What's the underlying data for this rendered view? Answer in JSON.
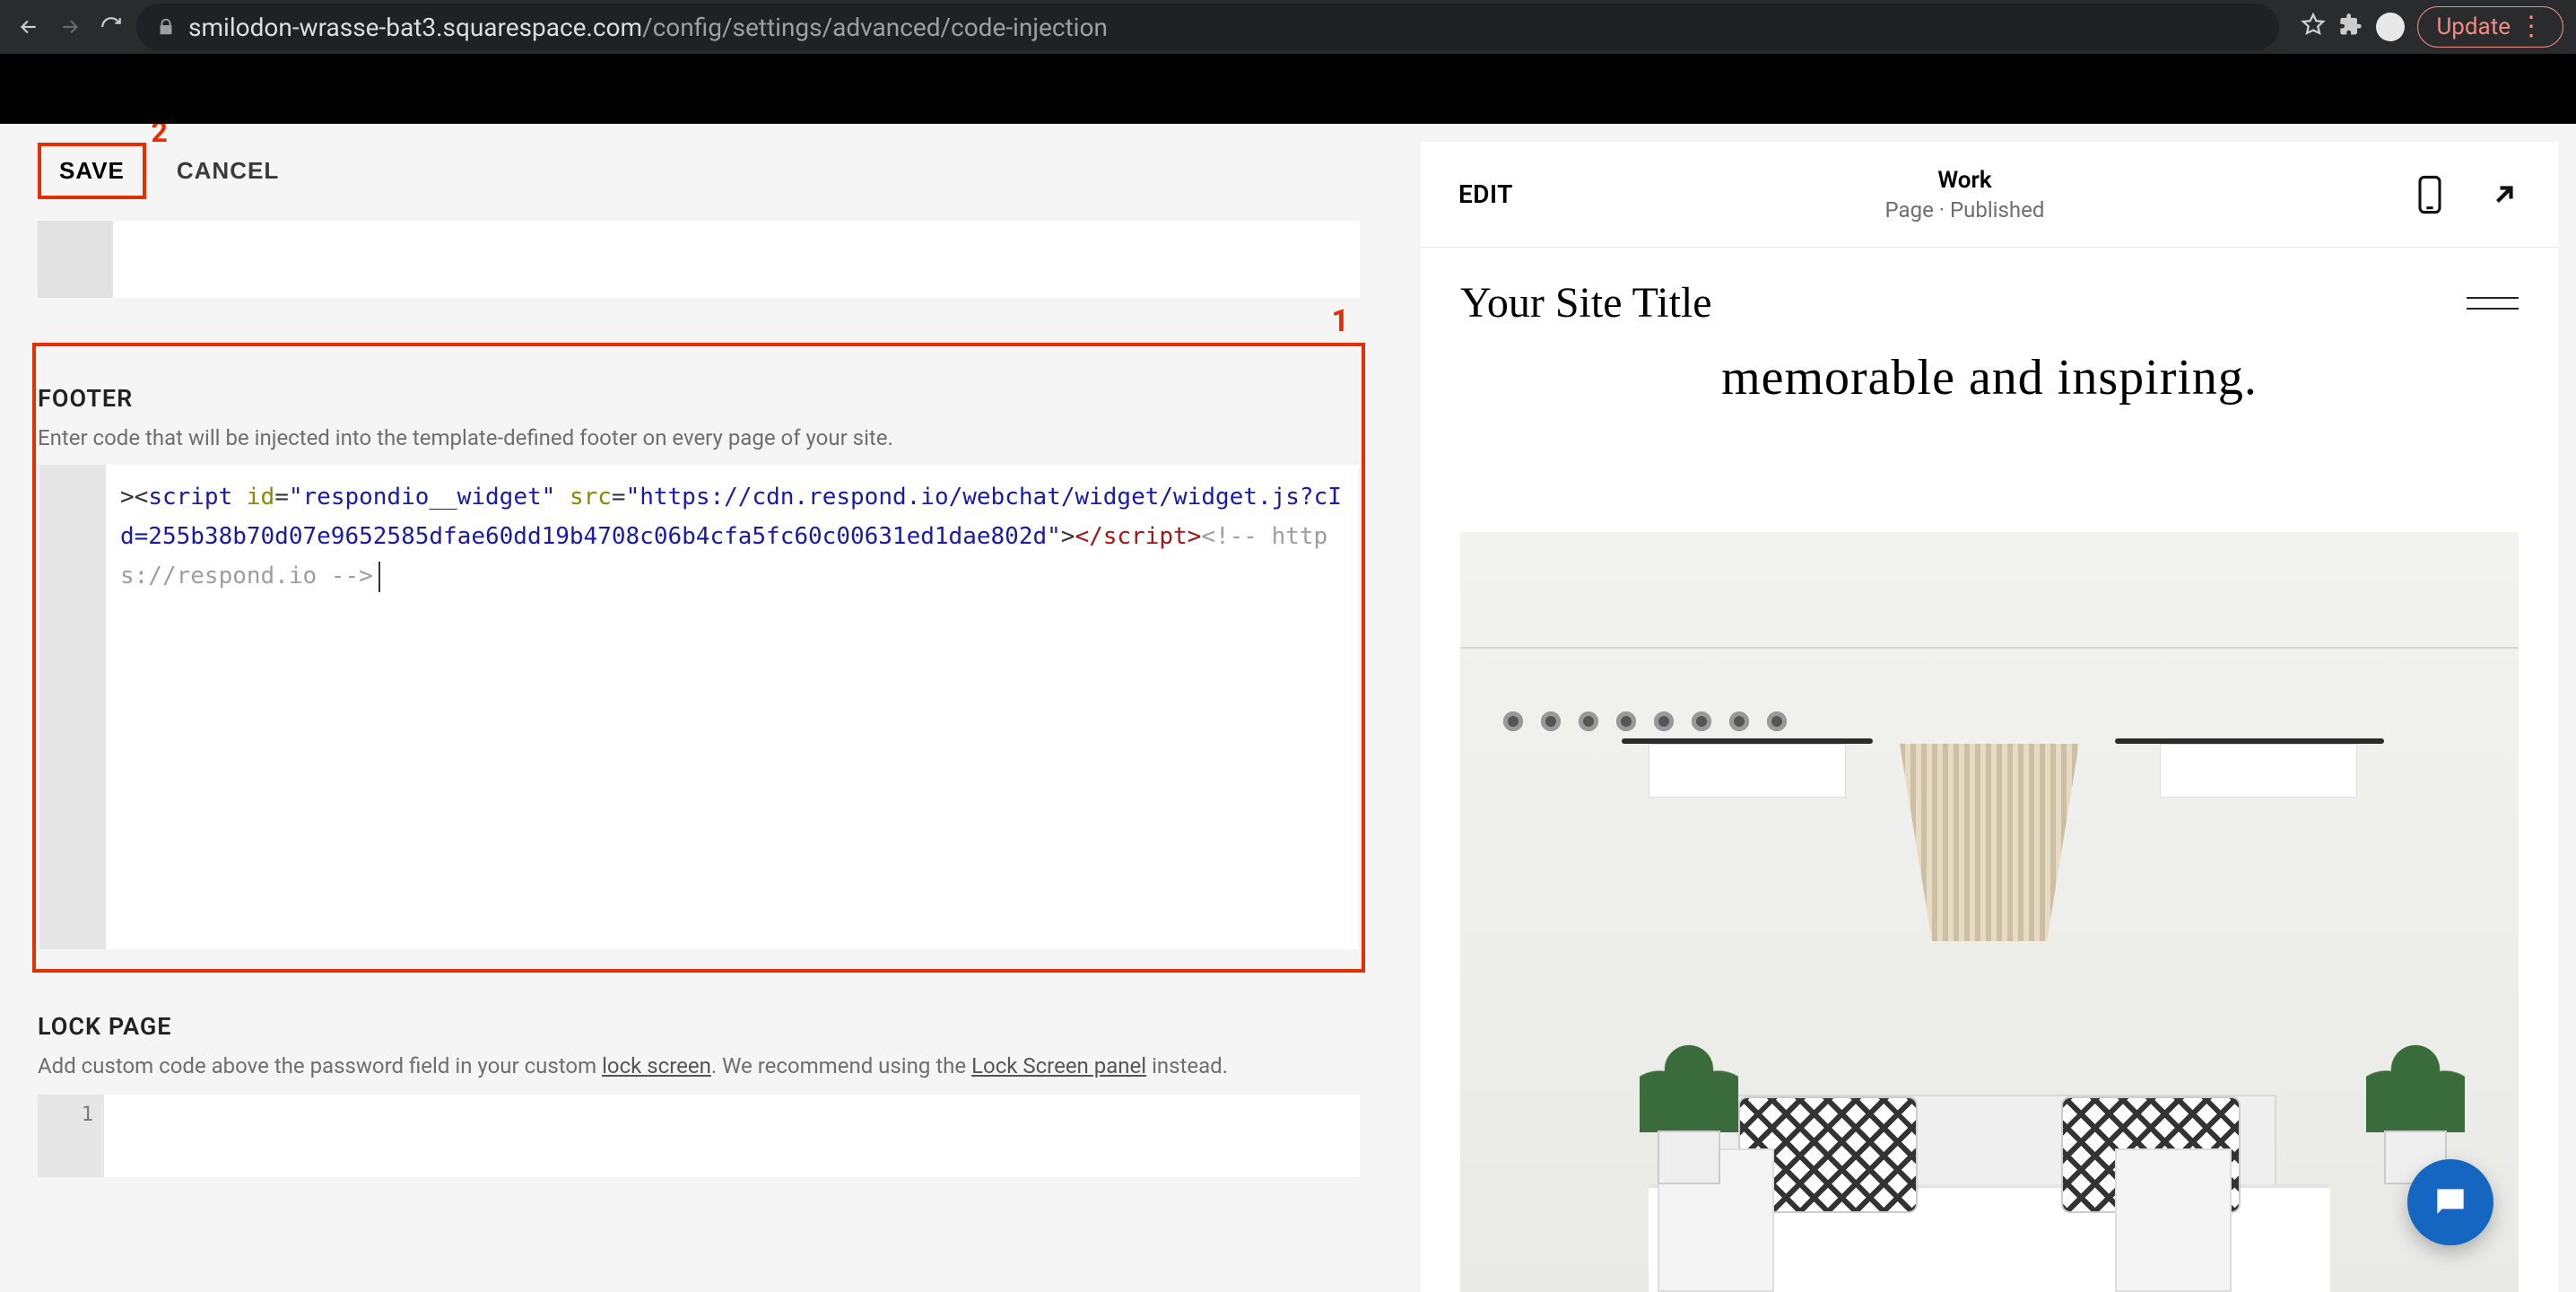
{
  "browser": {
    "url_host": "smilodon-wrasse-bat3.squarespace.com",
    "url_path": "/config/settings/advanced/code-injection",
    "update_label": "Update"
  },
  "toolbar": {
    "save": "SAVE",
    "cancel": "CANCEL"
  },
  "annotations": {
    "one": "1",
    "two": "2"
  },
  "footer_section": {
    "title": "FOOTER",
    "desc": "Enter code that will be injected into the template-defined footer on every page of your site.",
    "code": {
      "lead": ">",
      "open_b": "<",
      "tag": "script",
      "sp": " ",
      "attr_id": "id",
      "eq": "=",
      "q": "\"",
      "id_val": "respondio__widget",
      "attr_src": "src",
      "src_val": "https://cdn.respond.io/webchat/widget/widget.js?cId=255b38b70d07e9652585dfae60dd19b4708c06b4cfa5fc60c00631ed1dae802d",
      "close_b": ">",
      "end_open": "</",
      "cmt": "<!-- https://respond.io -->"
    }
  },
  "lock_section": {
    "title": "LOCK PAGE",
    "pre": "Add custom code above the password field in your custom ",
    "link1": "lock screen",
    "mid": ". We recommend using the ",
    "link2": "Lock Screen panel",
    "post": " instead.",
    "line1": "1"
  },
  "preview": {
    "edit": "EDIT",
    "title": "Work",
    "subtitle": "Page · Published",
    "site_title": "Your Site Title",
    "tagline": "memorable and inspiring."
  }
}
